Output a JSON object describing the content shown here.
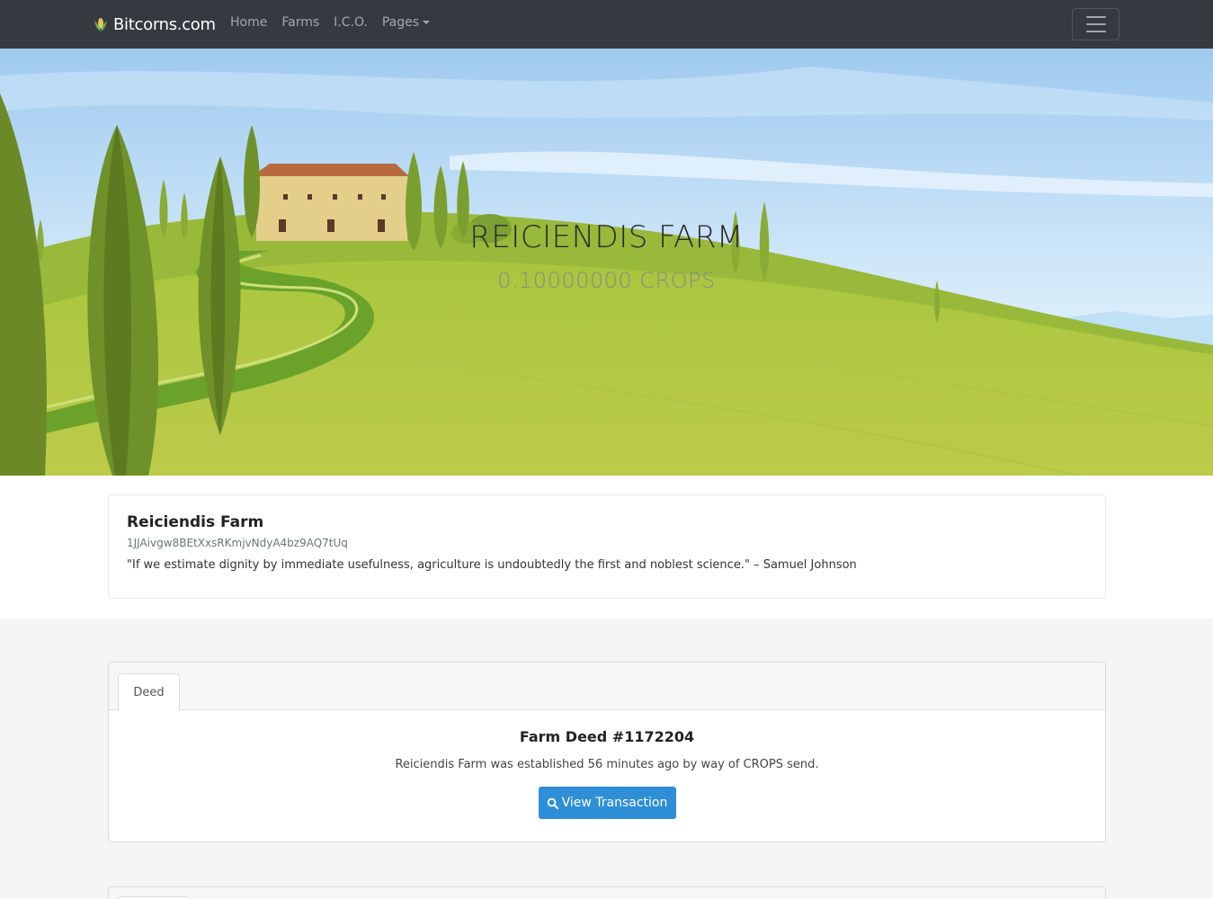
{
  "navbar": {
    "brand": "Bitcorns.com",
    "brand_icon": "corn-icon",
    "links": [
      {
        "label": "Home"
      },
      {
        "label": "Farms"
      },
      {
        "label": "I.C.O."
      },
      {
        "label": "Pages"
      }
    ],
    "toggler_icon": "hamburger-menu-icon"
  },
  "hero": {
    "title": "REICIENDIS FARM",
    "balance": "0.10000000 CROPS"
  },
  "farm_info": {
    "name": "Reiciendis Farm",
    "address": "1JJAivgw8BEtXxsRKmjvNdyA4bz9AQ7tUq",
    "quote": "\"If we estimate dignity by immediate usefulness, agriculture is undoubtedly the first and noblest science.\" – Samuel Johnson"
  },
  "deed_panel": {
    "tabs": [
      {
        "label": "Deed"
      }
    ],
    "title": "Farm Deed #1172204",
    "description": "Reiciendis Farm was established 56 minutes ago by way of CROPS send.",
    "button_label": "View Transaction",
    "button_icon": "search-icon",
    "button_color": "#2e8fd6"
  },
  "colors": {
    "navbar": "#343a40",
    "page_background": "#f5f5f5"
  }
}
